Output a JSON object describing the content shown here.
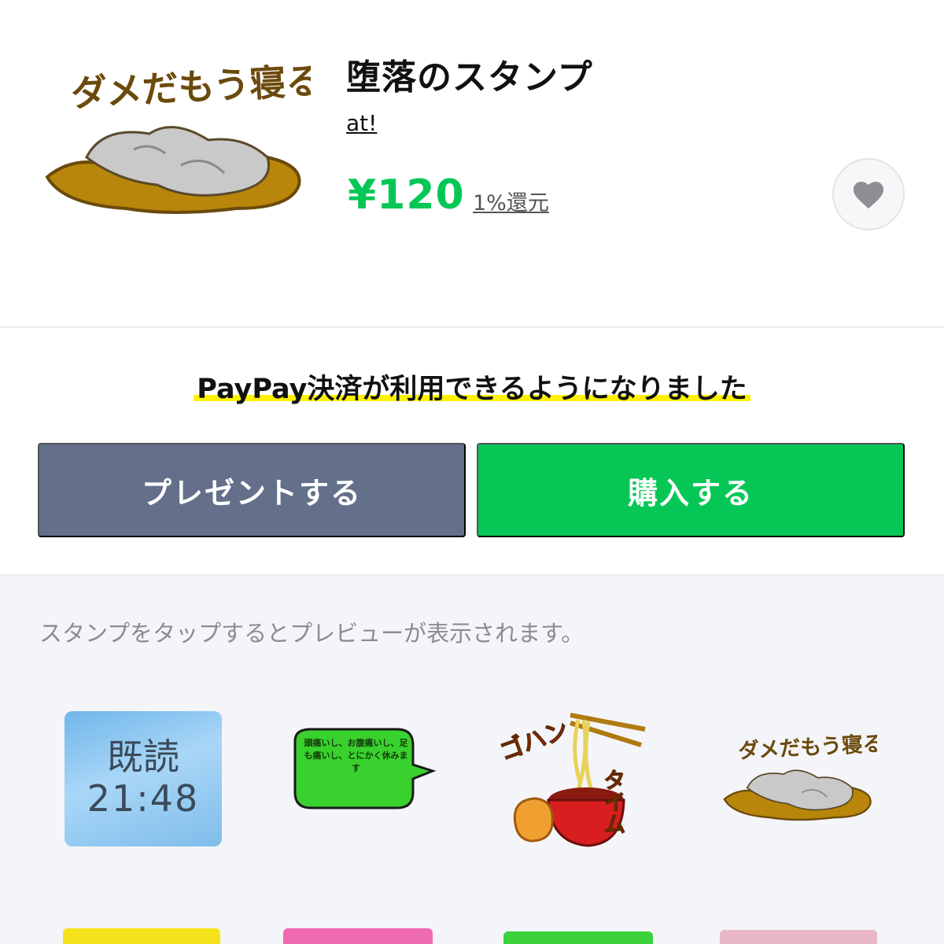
{
  "product": {
    "title": "堕落のスタンプ",
    "author": "at!",
    "price": "¥120",
    "cashback": "1%還元",
    "main_sticker_text": "ダメだもう寝る"
  },
  "notice": "PayPay決済が利用できるようになりました",
  "buttons": {
    "present": "プレゼントする",
    "buy": "購入する"
  },
  "preview": {
    "hint": "スタンプをタップするとプレビューが表示されます。",
    "stickers": [
      {
        "name": "kidoku",
        "line1": "既読",
        "line2": "21:48"
      },
      {
        "name": "sick-bubble",
        "text": "頭痛いし、お腹痛いし、足も痛いし、とにかく休みます"
      },
      {
        "name": "gohan-time",
        "text1": "ゴハン",
        "text2": "タイム"
      },
      {
        "name": "dame-sleep",
        "text": "ダメだもう寝る"
      }
    ]
  },
  "colors": {
    "accent_green": "#06c755",
    "present_gray": "#646f8a",
    "highlight_yellow": "#fff200"
  },
  "icons": {
    "favorite": "heart-icon"
  }
}
